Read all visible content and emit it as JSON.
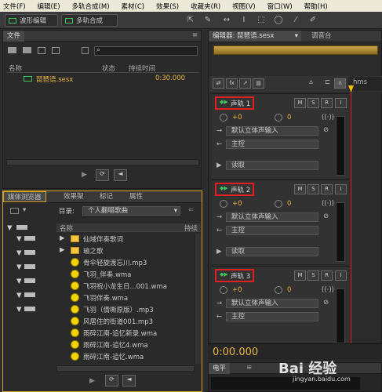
{
  "menu": [
    "文件(F)",
    "编辑(E)",
    "多轨合成(M)",
    "素材(C)",
    "效果(S)",
    "收藏夹(R)",
    "视图(V)",
    "窗口(W)",
    "帮助(H)"
  ],
  "toolbar": {
    "waveform": "波形编辑",
    "multitrack": "多轨合成"
  },
  "files": {
    "tab": "文件",
    "columns": [
      "名称",
      "状态",
      "持续时间"
    ],
    "items": [
      {
        "name": "琵琶语.sesx",
        "duration": "0:30.000"
      }
    ]
  },
  "media": {
    "tabs": [
      "媒体浏览器",
      "效果架",
      "标记",
      "属性"
    ],
    "directory_label": "目录:",
    "directory_value": "个人翻唱歌曲",
    "columns": [
      "名称",
      "持续"
    ],
    "items": [
      "仙域伴奏歌词",
      "瑜之歌",
      "骨伞轻旋渡忘川.mp3",
      "飞羽_伴奏.wma",
      "飞羽祝小龙生日...001.wma",
      "飞羽伴奏.wma",
      "飞羽（倩嘶原版）.mp3",
      "风居住的街道001.mp3",
      "雨碎江南-追忆新录.wma",
      "雨碎江南-追忆4.wma",
      "雨碎江南-追忆.wma"
    ]
  },
  "editor": {
    "tab": "编辑器: 琵琶语.sesx",
    "mixer_tab": "调音台",
    "ruler_unit": "hms",
    "time": "0:00.000"
  },
  "tracks": [
    {
      "name": "声轨 1",
      "m": "M",
      "s": "S",
      "r": "R",
      "i": "I",
      "volume": "+0",
      "pan": "0",
      "input": "默认立体声输入",
      "output": "主控",
      "mode": "读取"
    },
    {
      "name": "声轨 2",
      "m": "M",
      "s": "S",
      "r": "R",
      "i": "I",
      "volume": "+0",
      "pan": "0",
      "input": "默认立体声输入",
      "output": "主控",
      "mode": "读取"
    },
    {
      "name": "声轨 3",
      "m": "M",
      "s": "S",
      "r": "R",
      "i": "I",
      "volume": "+0",
      "pan": "0",
      "input": "默认立体声输入",
      "output": "主控"
    }
  ],
  "levels": {
    "tab": "电平"
  },
  "watermark": {
    "title": "Bai 经验",
    "url": "jingyan.baidu.com"
  }
}
